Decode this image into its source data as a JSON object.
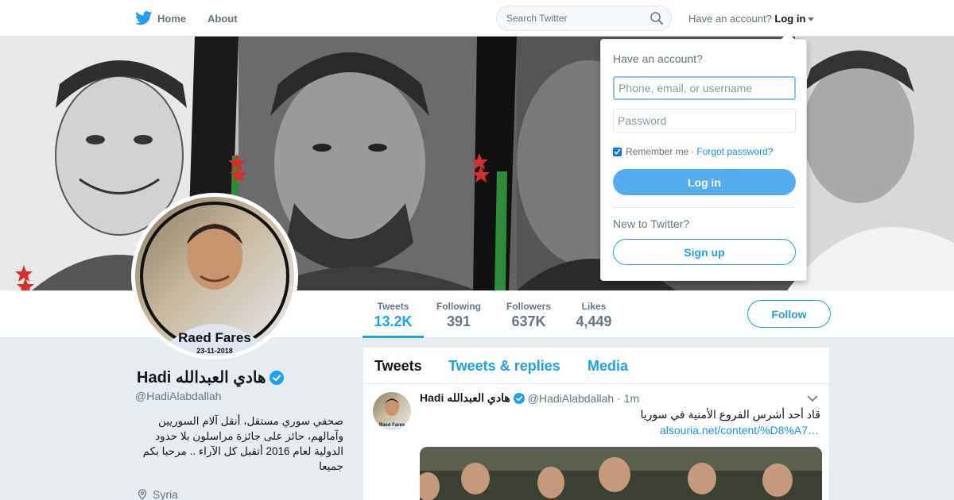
{
  "nav": {
    "home_label": "Home",
    "about_label": "About",
    "search_placeholder": "Search Twitter",
    "have_account": "Have an account?",
    "login_label": "Log in"
  },
  "profile": {
    "name": "Hadi هادي العبدالله",
    "handle": "@HadiAlabdallah",
    "bio": "صحفي سوري مستقل، أنقل آلام السوريين وآمالهم، حائز على جائزة مراسلون بلا حدود الدولية لعام 2016 أتقبل كل الآراء .. مرحبا بكم جميعا",
    "location": "Syria",
    "avatar_caption_name": "Raed Fares",
    "avatar_caption_date": "23-11-2018",
    "follow_label": "Follow"
  },
  "stats": [
    {
      "label": "Tweets",
      "value": "13.2K"
    },
    {
      "label": "Following",
      "value": "391"
    },
    {
      "label": "Followers",
      "value": "637K"
    },
    {
      "label": "Likes",
      "value": "4,449"
    }
  ],
  "tabs": [
    "Tweets",
    "Tweets & replies",
    "Media"
  ],
  "tweet": {
    "name": "Hadi هادي العبدالله",
    "handle": "@HadiAlabdallah",
    "time": "· 1m",
    "text": "قاد أحد أشرس الفروع الأمنية في سوريا",
    "link": "alsouria.net/content/%D8%A7…",
    "avatar_caption": "Raed Fares"
  },
  "login_dropdown": {
    "title": "Have an account?",
    "username_placeholder": "Phone, email, or username",
    "password_placeholder": "Password",
    "remember_me": "Remember me",
    "separator": "·",
    "forgot_password": "Forgot password?",
    "login_button": "Log in",
    "new_to_twitter": "New to Twitter?",
    "signup_button": "Sign up"
  },
  "colors": {
    "accent": "#1da1f2",
    "login_button_bg": "#55acee",
    "page_bg": "#e6ecf0"
  }
}
